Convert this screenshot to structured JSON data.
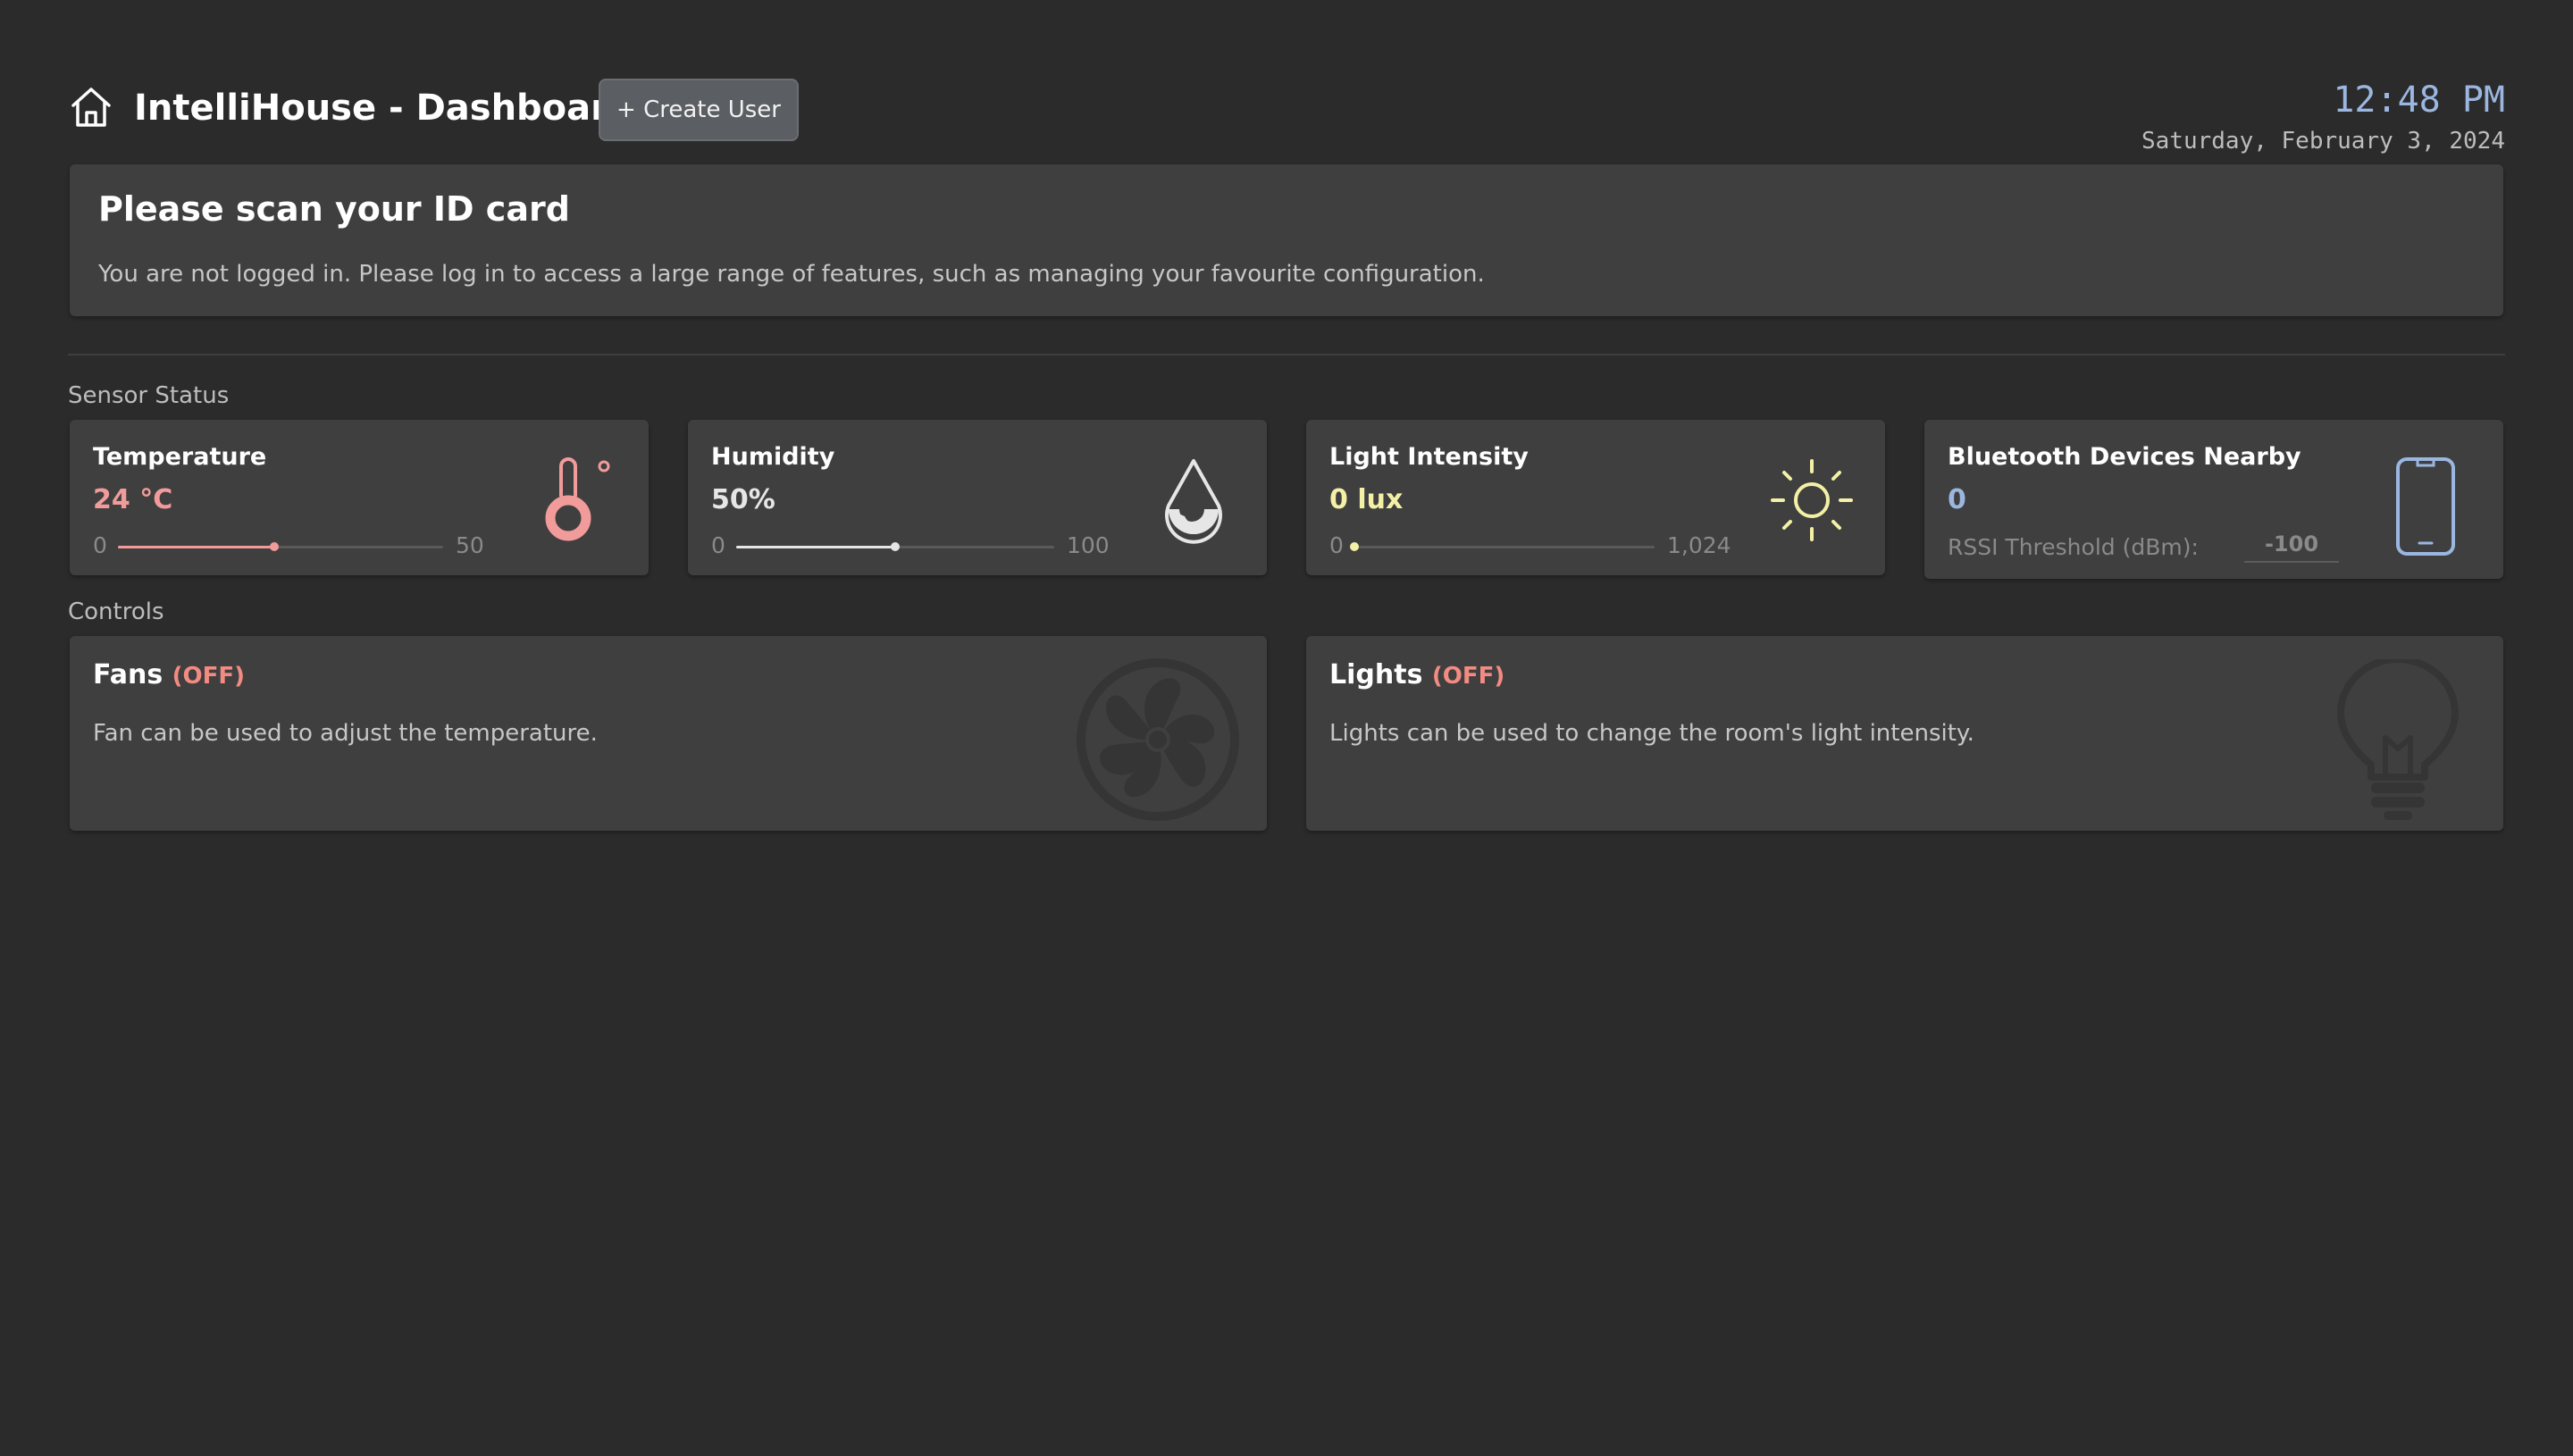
{
  "header": {
    "title": "IntelliHouse - Dashboard",
    "create_user_label": "+ Create User",
    "home_icon": "home-icon"
  },
  "clock": {
    "time": "12:48 PM",
    "date": "Saturday, February 3, 2024"
  },
  "login": {
    "title": "Please scan your ID card",
    "message": "You are not logged in. Please log in to access a large range of features, such as managing your favourite configuration."
  },
  "sections": {
    "sensors": "Sensor Status",
    "controls": "Controls"
  },
  "sensors": {
    "temperature": {
      "title": "Temperature",
      "value": "24 °C",
      "min": "0",
      "max": "50",
      "level": 0.48,
      "color": "#f29b9b",
      "icon": "thermometer-icon"
    },
    "humidity": {
      "title": "Humidity",
      "value": "50%",
      "min": "0",
      "max": "100",
      "level": 0.5,
      "color": "#e6e6e6",
      "icon": "water-drop-icon"
    },
    "light": {
      "title": "Light Intensity",
      "value": "0 lux",
      "min": "0",
      "max": "1,024",
      "level": 0.0,
      "color": "#f4f1a6",
      "icon": "sun-icon"
    },
    "bluetooth": {
      "title": "Bluetooth Devices Nearby",
      "value": "0",
      "rssi_label": "RSSI Threshold (dBm):",
      "rssi_value": "-100",
      "color": "#9bb6e0",
      "icon": "phone-icon"
    }
  },
  "controls": {
    "fans": {
      "name": "Fans",
      "state": "(OFF)",
      "description": "Fan can be used to adjust the temperature.",
      "icon": "fan-icon"
    },
    "lights": {
      "name": "Lights",
      "state": "(OFF)",
      "description": "Lights can be used to change the room's light intensity.",
      "icon": "light-bulb-icon"
    }
  }
}
